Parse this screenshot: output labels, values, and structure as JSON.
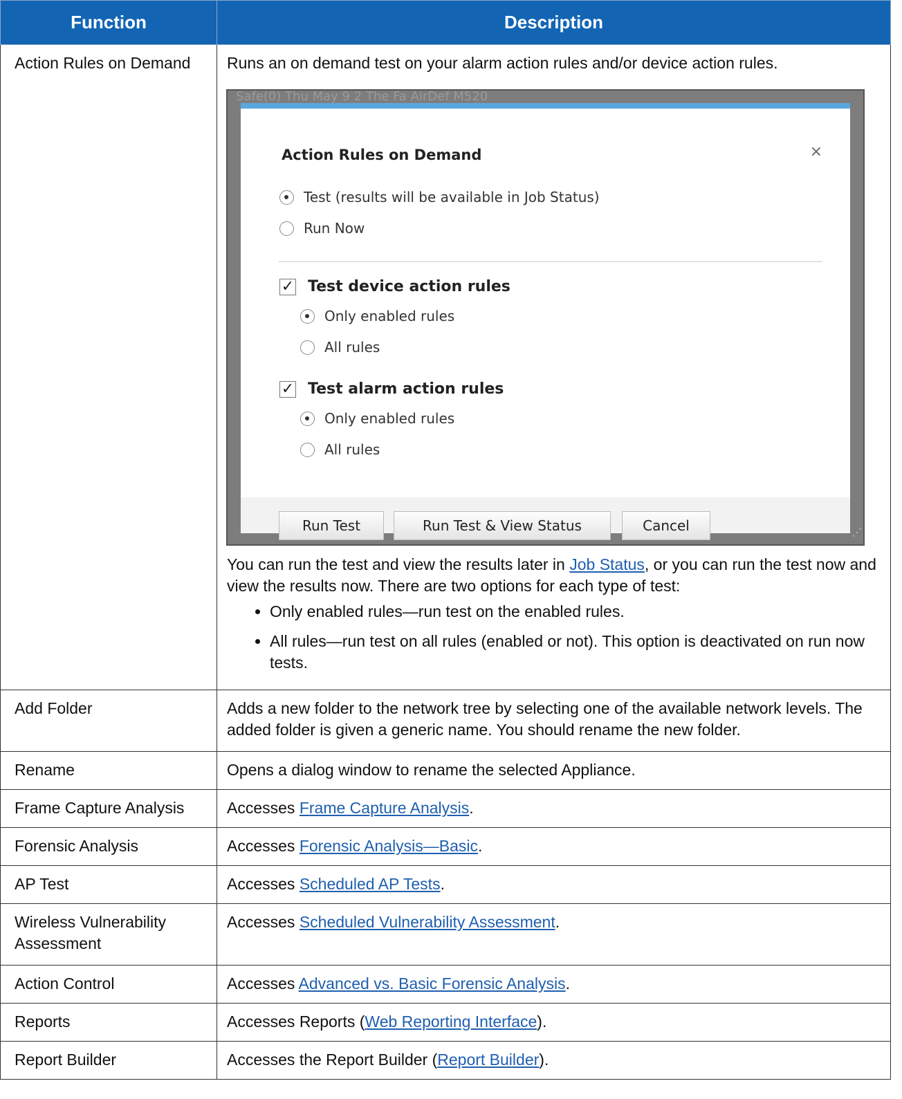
{
  "table": {
    "headers": [
      "Function",
      "Description"
    ],
    "rows": [
      {
        "func": "Action Rules on Demand",
        "desc": "Runs an on demand test on your alarm action rules and/or device action rules."
      },
      {
        "func": "Add Folder",
        "desc": "Adds a new folder to the network tree by selecting one of the available network levels. The added folder is given a generic name. You should rename the new folder."
      },
      {
        "func": "Rename",
        "desc": "Opens a dialog window to rename the selected Appliance."
      },
      {
        "func": "Frame Capture Analysis",
        "pre": "Accesses ",
        "link": "Frame Capture Analysis",
        "post": "."
      },
      {
        "func": "Forensic Analysis",
        "pre": "Accesses ",
        "link": "Forensic Analysis—Basic",
        "post": "."
      },
      {
        "func": "AP Test",
        "pre": "Accesses ",
        "link": "Scheduled AP Tests",
        "post": "."
      },
      {
        "func": "Wireless Vulnerability Assessment",
        "pre": "Accesses ",
        "link": "Scheduled Vulnerability Assessment",
        "post": "."
      },
      {
        "func": "Action Control",
        "pre": "Accesses ",
        "link": "Advanced vs. Basic Forensic Analysis",
        "post": "."
      },
      {
        "func": "Reports",
        "pre": "Accesses Reports (",
        "link": "Web Reporting Interface",
        "post": ")."
      },
      {
        "func": "Report Builder",
        "pre": "Accesses the Report Builder (",
        "link": "Report Builder",
        "post": ")."
      }
    ]
  },
  "dialog": {
    "background_strip": "Safe(0)      Thu May 9 2     The Fa     AirDef     M520",
    "title": "Action Rules on Demand",
    "close": "×",
    "mode_test": "Test (results will be available in Job Status)",
    "mode_run_now": "Run Now",
    "device_group": "Test device action rules",
    "alarm_group": "Test alarm action rules",
    "only_enabled": "Only enabled rules",
    "all_rules": "All rules",
    "btn_run_test": "Run Test",
    "btn_run_view": "Run Test & View Status",
    "btn_cancel": "Cancel"
  },
  "after_text": {
    "pre": "You can run the test and view the results later in ",
    "link": "Job Status",
    "post": ", or you can run the test now and view the results now. There are two options for each type of test:",
    "bullets": [
      "Only enabled rules—run test on the enabled rules.",
      "All rules—run test on all rules (enabled or not). This option is deactivated on run now tests."
    ]
  },
  "colors": {
    "header_bg": "#1365b4",
    "link": "#1f5fb0",
    "dialog_accent": "#5aa7de"
  }
}
